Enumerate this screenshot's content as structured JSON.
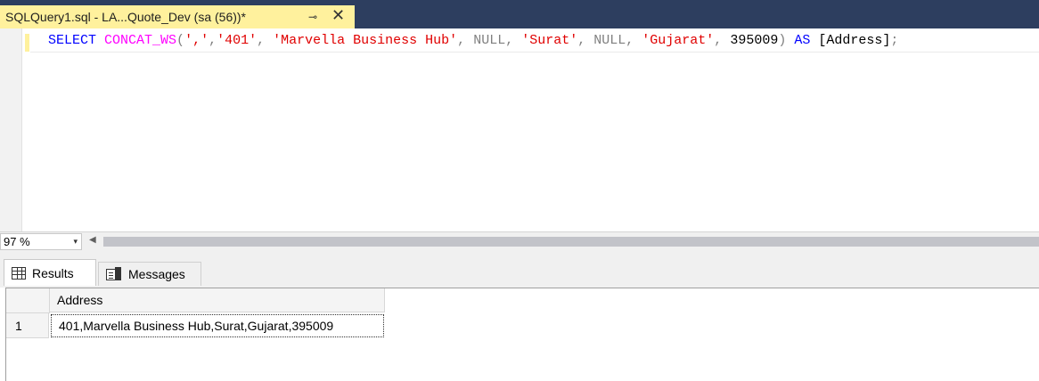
{
  "tab": {
    "title": "SQLQuery1.sql - LA...Quote_Dev (sa (56))*",
    "pin_glyph": "⊸",
    "close_glyph": "✕"
  },
  "editor": {
    "tokens": [
      {
        "text": "SELECT",
        "cls": "kw"
      },
      {
        "text": " ",
        "cls": ""
      },
      {
        "text": "CONCAT_WS",
        "cls": "fn"
      },
      {
        "text": "(",
        "cls": "gray"
      },
      {
        "text": "','",
        "cls": "str"
      },
      {
        "text": ",",
        "cls": "gray"
      },
      {
        "text": "'401'",
        "cls": "str"
      },
      {
        "text": ", ",
        "cls": "gray"
      },
      {
        "text": "'Marvella Business Hub'",
        "cls": "str"
      },
      {
        "text": ", ",
        "cls": "gray"
      },
      {
        "text": "NULL",
        "cls": "gray"
      },
      {
        "text": ", ",
        "cls": "gray"
      },
      {
        "text": "'Surat'",
        "cls": "str"
      },
      {
        "text": ", ",
        "cls": "gray"
      },
      {
        "text": "NULL",
        "cls": "gray"
      },
      {
        "text": ", ",
        "cls": "gray"
      },
      {
        "text": "'Gujarat'",
        "cls": "str"
      },
      {
        "text": ", ",
        "cls": "gray"
      },
      {
        "text": "395009",
        "cls": "num"
      },
      {
        "text": ")",
        "cls": "gray"
      },
      {
        "text": " ",
        "cls": ""
      },
      {
        "text": "AS",
        "cls": "kw"
      },
      {
        "text": " [Address]",
        "cls": "num"
      },
      {
        "text": ";",
        "cls": "gray"
      }
    ]
  },
  "zoom": {
    "value": "97 %",
    "arrow": "▾",
    "scroll_left": "◀"
  },
  "result_tabs": {
    "results_label": "Results",
    "messages_label": "Messages"
  },
  "grid": {
    "column_header": "Address",
    "rows": [
      {
        "num": "1",
        "value": "401,Marvella Business Hub,Surat,Gujarat,395009"
      }
    ]
  },
  "colors": {
    "tab_active": "#fff19d",
    "tabstrip": "#2d3e5f",
    "keyword": "#0000ff",
    "function": "#ff00ff",
    "string": "#e00000",
    "operator": "#808080"
  }
}
